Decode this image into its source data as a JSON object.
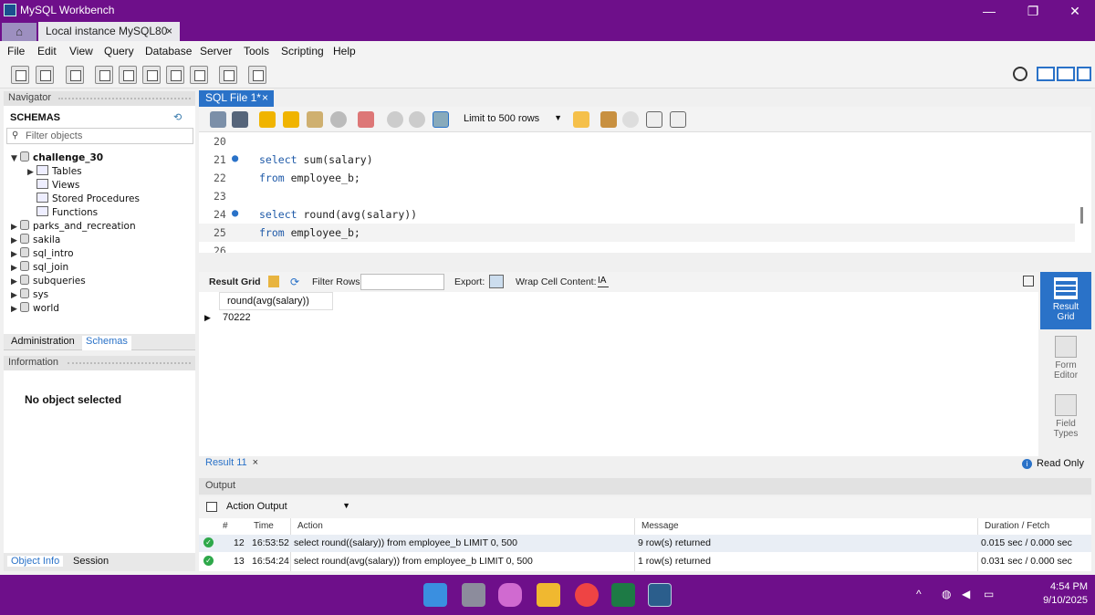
{
  "window": {
    "title": "MySQL Workbench",
    "minimize": "—",
    "maximize": "❐",
    "close": "✕"
  },
  "tabs": {
    "home": "⌂",
    "instance": "Local instance MySQL80",
    "close": "×"
  },
  "menu": [
    "File",
    "Edit",
    "View",
    "Query",
    "Database",
    "Server",
    "Tools",
    "Scripting",
    "Help"
  ],
  "navigator": {
    "header": "Navigator",
    "schemas_title": "SCHEMAS",
    "filter_placeholder": "Filter objects",
    "tree": {
      "expanded_db": "challenge_30",
      "children": [
        "Tables",
        "Views",
        "Stored Procedures",
        "Functions"
      ],
      "dbs": [
        "parks_and_recreation",
        "sakila",
        "sql_intro",
        "sql_join",
        "subqueries",
        "sys",
        "world"
      ]
    },
    "admin_tab": "Administration",
    "schemas_tab": "Schemas"
  },
  "information": {
    "header": "Information",
    "message": "No object selected",
    "tab_object_info": "Object Info",
    "tab_session": "Session"
  },
  "editor": {
    "tab": "SQL File 1*",
    "limit": "Limit to 500 rows",
    "lines": [
      {
        "n": "20",
        "kw": "",
        "rest": "",
        "dot": ""
      },
      {
        "n": "21",
        "kw": "select",
        "rest": " sum(salary)",
        "dot": "●"
      },
      {
        "n": "22",
        "kw": "from",
        "rest": " employee_b;",
        "dot": ""
      },
      {
        "n": "23",
        "kw": "",
        "rest": "",
        "dot": ""
      },
      {
        "n": "24",
        "kw": "select",
        "rest": " round(avg(salary))",
        "dot": "●"
      },
      {
        "n": "25",
        "kw": "from",
        "rest": " employee_b;",
        "dot": ""
      },
      {
        "n": "26",
        "kw": "",
        "rest": "",
        "dot": ""
      }
    ]
  },
  "result": {
    "grid_label": "Result Grid",
    "filter_label": "Filter Rows:",
    "export_label": "Export:",
    "wrap_label": "Wrap Cell Content:",
    "column": "round(avg(salary))",
    "value": "70222",
    "tab": "Result 11",
    "readonly": "Read Only"
  },
  "side": {
    "result_grid": [
      "Result",
      "Grid"
    ],
    "form_editor": [
      "Form",
      "Editor"
    ],
    "field_types": [
      "Field",
      "Types"
    ]
  },
  "output": {
    "header": "Output",
    "select": "Action Output",
    "columns": [
      "#",
      "Time",
      "Action",
      "Message",
      "Duration / Fetch"
    ],
    "rows": [
      {
        "num": "12",
        "time": "16:53:52",
        "action": "select round((salary)) from employee_b LIMIT 0, 500",
        "message": "9 row(s) returned",
        "duration": "0.015 sec / 0.000 sec"
      },
      {
        "num": "13",
        "time": "16:54:24",
        "action": "select round(avg(salary)) from employee_b LIMIT 0, 500",
        "message": "1 row(s) returned",
        "duration": "0.031 sec / 0.000 sec"
      }
    ]
  },
  "taskbar": {
    "time": "4:54 PM",
    "date": "9/10/2025"
  }
}
